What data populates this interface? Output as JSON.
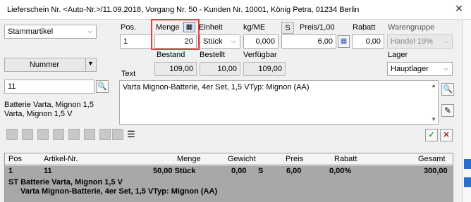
{
  "window": {
    "title": "Lieferschein Nr. <Auto-Nr.>/11.09.2018, Vorgang Nr. 50 - Kunden Nr. 10001, König Petra, 01234 Berlin",
    "close_glyph": "✕"
  },
  "left": {
    "article_type": "Stammartikel",
    "search_mode": "Nummer",
    "search_value": "11",
    "article_desc_line1": "Batterie Varta, Mignon 1,5",
    "article_desc_line2": "Varta, Mignon 1,5 V"
  },
  "fields": {
    "pos_label": "Pos.",
    "pos_value": "1",
    "menge_label": "Menge",
    "menge_value": "20",
    "einheit_label": "Einheit",
    "einheit_value": "Stück",
    "kg_label": "kg/ME",
    "kg_value": "0,000",
    "s_button": "S",
    "preis_label": "Preis/1,00",
    "preis_value": "6,00",
    "rabatt_label": "Rabatt",
    "rabatt_value": "0,00",
    "warengruppe_label": "Warengruppe",
    "warengruppe_value": "Handel 19%",
    "bestand_label": "Bestand",
    "bestand_value": "109,00",
    "bestellt_label": "Bestellt",
    "bestellt_value": "10,00",
    "verfuegbar_label": "Verfügbar",
    "verfuegbar_value": "109,00",
    "lager_label": "Lager",
    "lager_value": "Hauptlager",
    "text_label": "Text",
    "text_value": "Varta Mignon-Batterie, 4er Set, 1,5 VTyp: Mignon (AA)"
  },
  "actions": {
    "ok_glyph": "✓",
    "cancel_glyph": "✕"
  },
  "grid": {
    "headers": [
      "Pos",
      "Artikel-Nr.",
      "Menge",
      "Gewicht",
      "Preis",
      "Rabatt",
      "Gesamt"
    ],
    "row": {
      "pos": "1",
      "artikel": "11",
      "menge": "50,00 Stück",
      "gewicht": "0,00",
      "s": "S",
      "preis": "6,00",
      "rabatt": "0,00%",
      "gesamt": "300,00",
      "desc1": "ST Batterie Varta, Mignon 1,5 V",
      "desc2": "Varta Mignon-Batterie, 4er Set, 1,5 VTyp: Mignon (AA)"
    }
  },
  "colors": {
    "highlight": "#e0433c",
    "ok_green": "#2e9a2e",
    "cancel_red": "#c02020",
    "selected_row": "#a8a8a8"
  }
}
